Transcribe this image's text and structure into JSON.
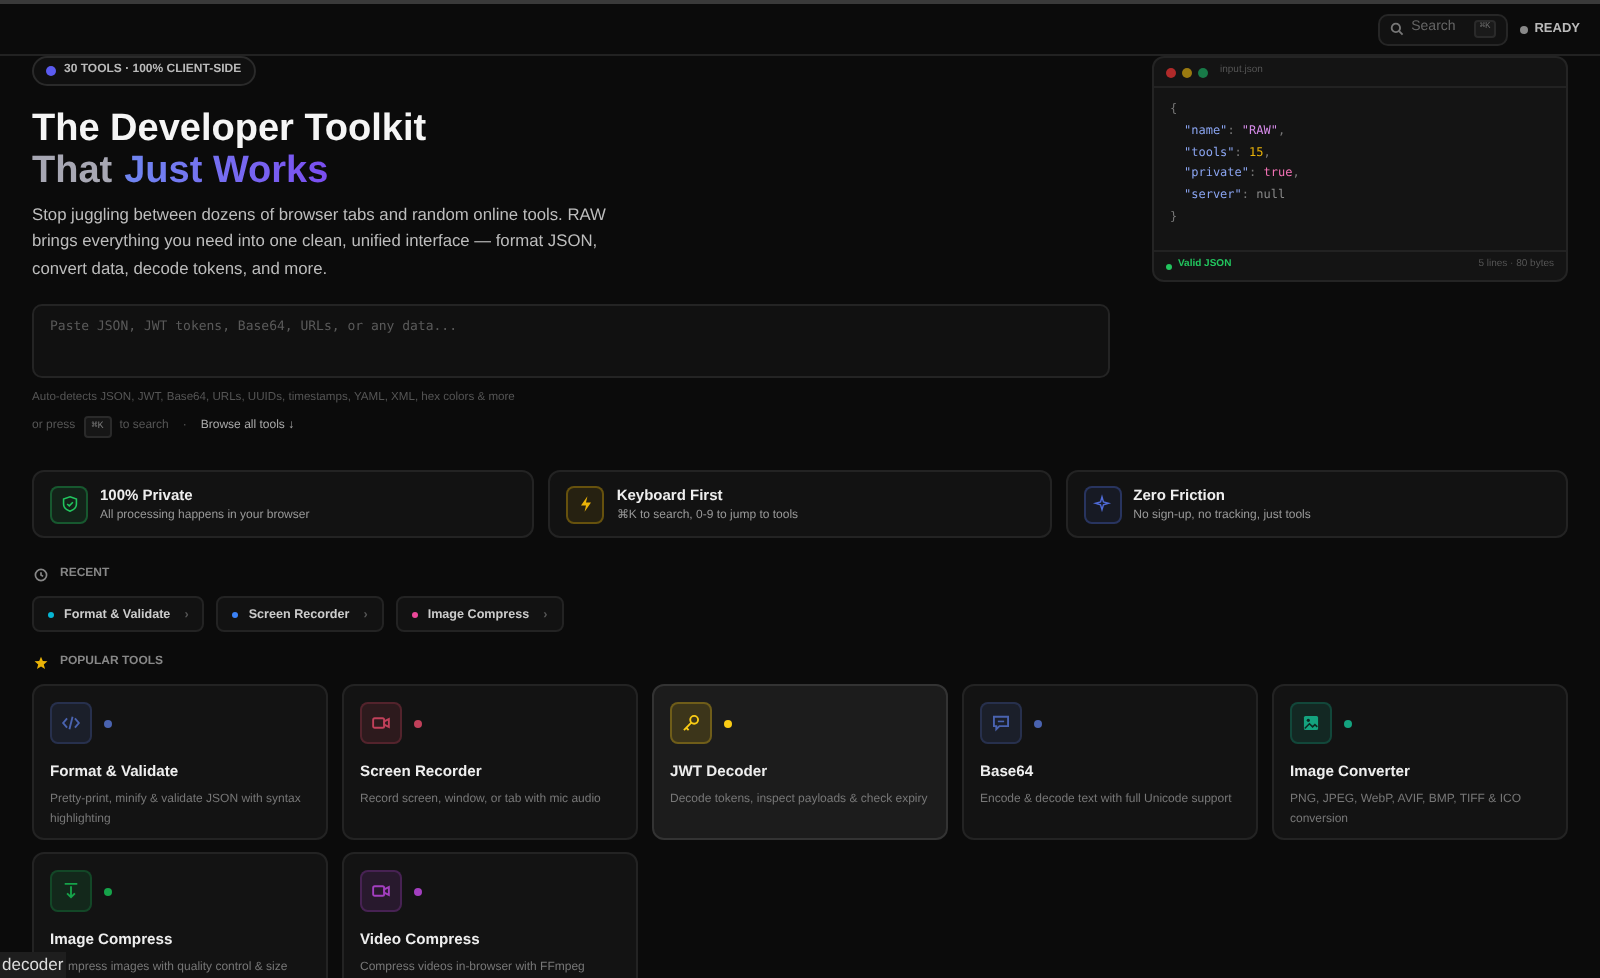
{
  "header": {
    "search": {
      "label": "Search",
      "shortcut": "⌘K"
    },
    "status": "READY"
  },
  "hero": {
    "badge": "30 TOOLS · 100% CLIENT-SIDE",
    "title_line1": "The Developer Toolkit",
    "title_line2": [
      {
        "text": "That",
        "kind": "plain"
      },
      {
        "text": "Just Works",
        "kind": "accent"
      }
    ],
    "description": "Stop juggling between dozens of browser tabs and random online tools. RAW brings everything you need into one clean, unified interface — format JSON, convert data, decode tokens, and more.",
    "input": {
      "placeholder": "Paste JSON, JWT tokens, Base64, URLs, or any data..."
    },
    "hint": "Auto-detects JSON, JWT, Base64, URLs, UUIDs, timestamps, YAML, XML, hex colors & more",
    "shortcut_prefix": "or press",
    "shortcut_key": "⌘K",
    "shortcut_suffix": "to search",
    "separator": "·",
    "browse_link": "Browse all tools ↓"
  },
  "preview": {
    "filename": "input.json",
    "lines": [
      [
        {
          "text": "{",
          "kind": "punct"
        }
      ],
      [
        {
          "text": "\"name\"",
          "kind": "key"
        },
        {
          "text": ": ",
          "kind": "punct"
        },
        {
          "text": "\"RAW\"",
          "kind": "string"
        },
        {
          "text": ",",
          "kind": "punct"
        }
      ],
      [
        {
          "text": "\"tools\"",
          "kind": "key"
        },
        {
          "text": ": ",
          "kind": "punct"
        },
        {
          "text": "15",
          "kind": "number"
        },
        {
          "text": ",",
          "kind": "punct"
        }
      ],
      [
        {
          "text": "\"private\"",
          "kind": "key"
        },
        {
          "text": ": ",
          "kind": "punct"
        },
        {
          "text": "true",
          "kind": "bool"
        },
        {
          "text": ",",
          "kind": "punct"
        }
      ],
      [
        {
          "text": "\"server\"",
          "kind": "key"
        },
        {
          "text": ": ",
          "kind": "punct"
        },
        {
          "text": "null",
          "kind": "null"
        }
      ],
      [
        {
          "text": "}",
          "kind": "punct"
        }
      ]
    ],
    "status": "Valid JSON",
    "stats": "5 lines · 80 bytes"
  },
  "features": [
    {
      "title": "100% Private",
      "text": "All processing happens in your browser",
      "color": "#22c55e"
    },
    {
      "title": "Keyboard First",
      "text": "⌘K to search, 0-9 to jump to tools",
      "color": "#eab308"
    },
    {
      "title": "Zero Friction",
      "text": "No sign-up, no tracking, just tools",
      "color": "#4f6bd8"
    }
  ],
  "recent": {
    "heading": "RECENT",
    "items": [
      {
        "label": "Format & Validate",
        "color": "#06b6d4",
        "arrow": "›"
      },
      {
        "label": "Screen Recorder",
        "color": "#3b82f6",
        "arrow": "›"
      },
      {
        "label": "Image Compress",
        "color": "#ec4899",
        "arrow": "›"
      }
    ]
  },
  "popular": {
    "heading": "POPULAR TOOLS",
    "tools": [
      {
        "title": "Format & Validate",
        "text": "Pretty-print, minify & validate JSON with syntax highlighting",
        "color": "#4a63b0",
        "hovered": false
      },
      {
        "title": "Screen Recorder",
        "text": "Record screen, window, or tab with mic audio",
        "color": "#c0405a",
        "hovered": false
      },
      {
        "title": "JWT Decoder",
        "text": "Decode tokens, inspect payloads & check expiry",
        "color": "#facc15",
        "hovered": true
      },
      {
        "title": "Base64",
        "text": "Encode & decode text with full Unicode support",
        "color": "#4a63b0",
        "hovered": false
      },
      {
        "title": "Image Converter",
        "text": "PNG, JPEG, WebP, AVIF, BMP, TIFF & ICO conversion",
        "color": "#14a37f",
        "hovered": false
      },
      {
        "title": "Image Compress",
        "text": "mpress images with quality control & size",
        "color": "#16a34a",
        "hovered": false
      },
      {
        "title": "Video Compress",
        "text": "Compress videos in-browser with FFmpeg",
        "color": "#a33fc0",
        "hovered": false
      }
    ]
  },
  "tooltip": "decoder"
}
